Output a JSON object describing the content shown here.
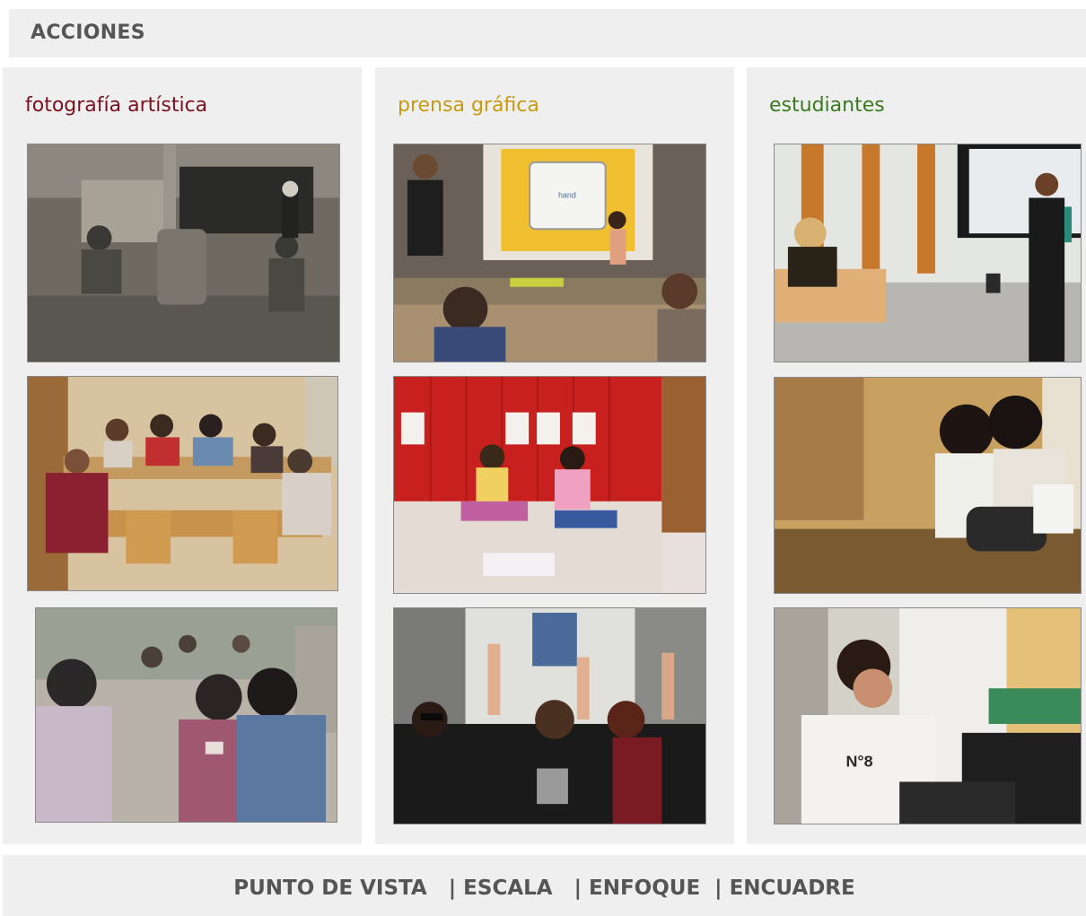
{
  "header": {
    "title": "ACCIONES"
  },
  "columns": [
    {
      "title": "fotografía artística",
      "color": "#7a1020",
      "photos": [
        {
          "name": "photo-historic-classroom-stove"
        },
        {
          "name": "photo-library-students-reading"
        },
        {
          "name": "photo-street-crowd-vintage"
        }
      ]
    },
    {
      "title": "prensa gráfica",
      "color": "#c89a10",
      "photos": [
        {
          "name": "photo-interactive-whiteboard-class",
          "board_word": "hand"
        },
        {
          "name": "photo-girls-sitting-by-red-lockers"
        },
        {
          "name": "photo-students-protest-raised-hands"
        }
      ]
    },
    {
      "title": "estudiantes",
      "color": "#3a7a20",
      "photos": [
        {
          "name": "photo-teacher-presenting-classroom"
        },
        {
          "name": "photo-two-girls-studying-table"
        },
        {
          "name": "photo-girl-working-laptop",
          "shirt_text": "N°8"
        }
      ]
    }
  ],
  "footer": {
    "text": "PUNTO DE VISTA   | ESCALA   | ENFOQUE  | ENCUADRE"
  }
}
